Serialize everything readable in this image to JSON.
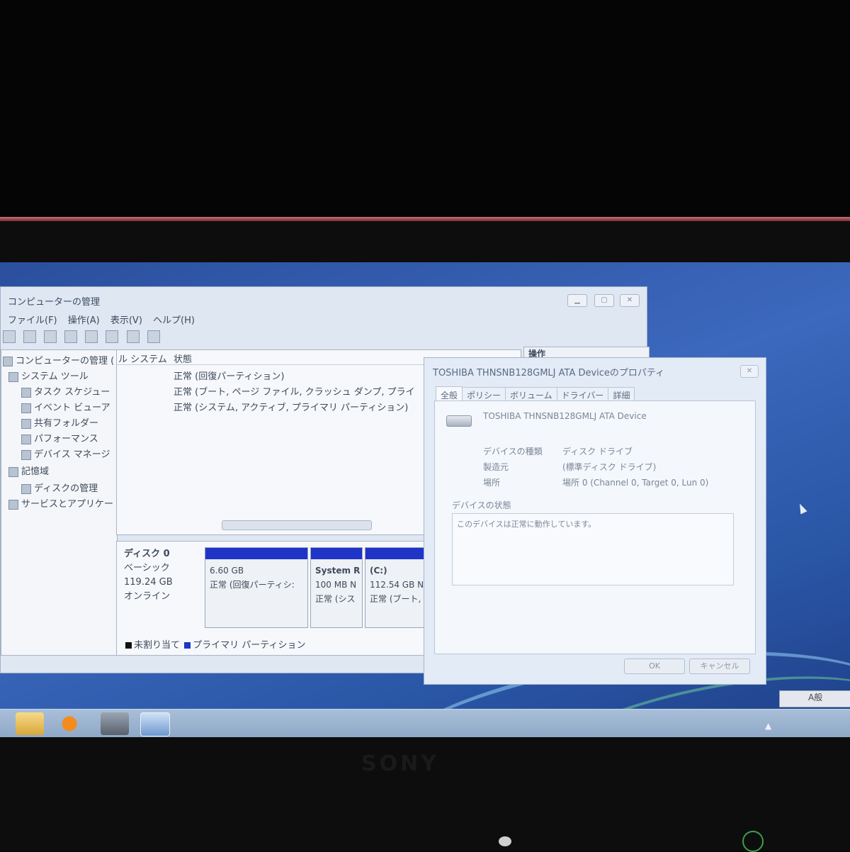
{
  "computer_management": {
    "title": "コンピューターの管理",
    "menu": [
      "ファイル(F)",
      "操作(A)",
      "表示(V)",
      "ヘルプ(H)"
    ],
    "tree": [
      "コンピューターの管理 (",
      "システム ツール",
      "タスク スケジュー",
      "イベント ビューア",
      "共有フォルダー",
      "パフォーマンス",
      "デバイス マネージ",
      "記憶域",
      "ディスクの管理",
      "サービスとアプリケー"
    ],
    "columns": [
      "ル システム",
      "状態"
    ],
    "rows": [
      "正常 (回復パーティション)",
      "正常 (ブート, ページ ファイル, クラッシュ ダンプ, プライ",
      "正常 (システム, アクティブ, プライマリ パーティション)"
    ],
    "actions_label": "操作",
    "disk": {
      "name": "ディスク 0",
      "type": "ベーシック",
      "size": "119.24 GB",
      "status": "オンライン"
    },
    "partitions": [
      {
        "name": "",
        "size": "6.60 GB",
        "status": "正常 (回復パーティシ:"
      },
      {
        "name": "System R",
        "size": "100 MB N",
        "status": "正常 (シス"
      },
      {
        "name": "(C:)",
        "size": "112.54 GB N",
        "status": "正常 (ブート,"
      }
    ],
    "legend": [
      "未割り当て",
      "プライマリ パーティション"
    ],
    "colors": {
      "primary_partition": "#1f35c7",
      "unallocated": "#111111"
    }
  },
  "properties_dialog": {
    "title": "TOSHIBA THNSNB128GMLJ ATA Deviceのプロパティ",
    "tabs": [
      "全般",
      "ポリシー",
      "ボリューム",
      "ドライバー",
      "詳細"
    ],
    "device_name": "TOSHIBA THNSNB128GMLJ ATA Device",
    "props": [
      {
        "label": "デバイスの種類",
        "value": "ディスク ドライブ"
      },
      {
        "label": "製造元",
        "value": "(標準ディスク ドライブ)"
      },
      {
        "label": "場所",
        "value": "場所 0 (Channel 0, Target 0, Lun 0)"
      }
    ],
    "status_group": "デバイスの状態",
    "status_text": "このデバイスは正常に動作しています。",
    "ok": "OK",
    "cancel": "キャンセル"
  },
  "taskbar": {
    "langbar": "A般"
  },
  "bezel": {
    "brand": "SONY"
  }
}
